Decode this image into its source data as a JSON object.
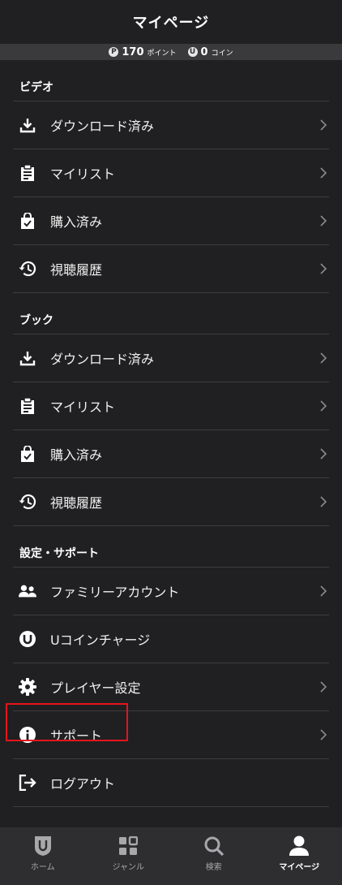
{
  "header": {
    "title": "マイページ"
  },
  "points": {
    "point_badge": "P",
    "point_value": "170",
    "point_unit": "ポイント",
    "coin_badge": "U",
    "coin_value": "0",
    "coin_unit": "コイン"
  },
  "video": {
    "title": "ビデオ",
    "items": [
      {
        "label": "ダウンロード済み",
        "icon": "download-icon"
      },
      {
        "label": "マイリスト",
        "icon": "clipboard-icon"
      },
      {
        "label": "購入済み",
        "icon": "shopping-bag-check-icon"
      },
      {
        "label": "視聴履歴",
        "icon": "history-icon"
      }
    ]
  },
  "book": {
    "title": "ブック",
    "items": [
      {
        "label": "ダウンロード済み",
        "icon": "download-icon"
      },
      {
        "label": "マイリスト",
        "icon": "clipboard-icon"
      },
      {
        "label": "購入済み",
        "icon": "shopping-bag-check-icon"
      },
      {
        "label": "視聴履歴",
        "icon": "history-icon"
      }
    ]
  },
  "settings": {
    "title": "設定・サポート",
    "items": [
      {
        "label": "ファミリーアカウント",
        "icon": "family-icon"
      },
      {
        "label": "Uコインチャージ",
        "icon": "u-coin-icon"
      },
      {
        "label": "プレイヤー設定",
        "icon": "gear-icon"
      },
      {
        "label": "サポート",
        "icon": "info-icon"
      },
      {
        "label": "ログアウト",
        "icon": "logout-icon"
      }
    ]
  },
  "nav": {
    "home": "ホーム",
    "genre": "ジャンル",
    "search": "検索",
    "mypage": "マイページ"
  },
  "colors": {
    "background": "#202022",
    "highlight": "#e5141b",
    "divider": "#3d3d40"
  }
}
